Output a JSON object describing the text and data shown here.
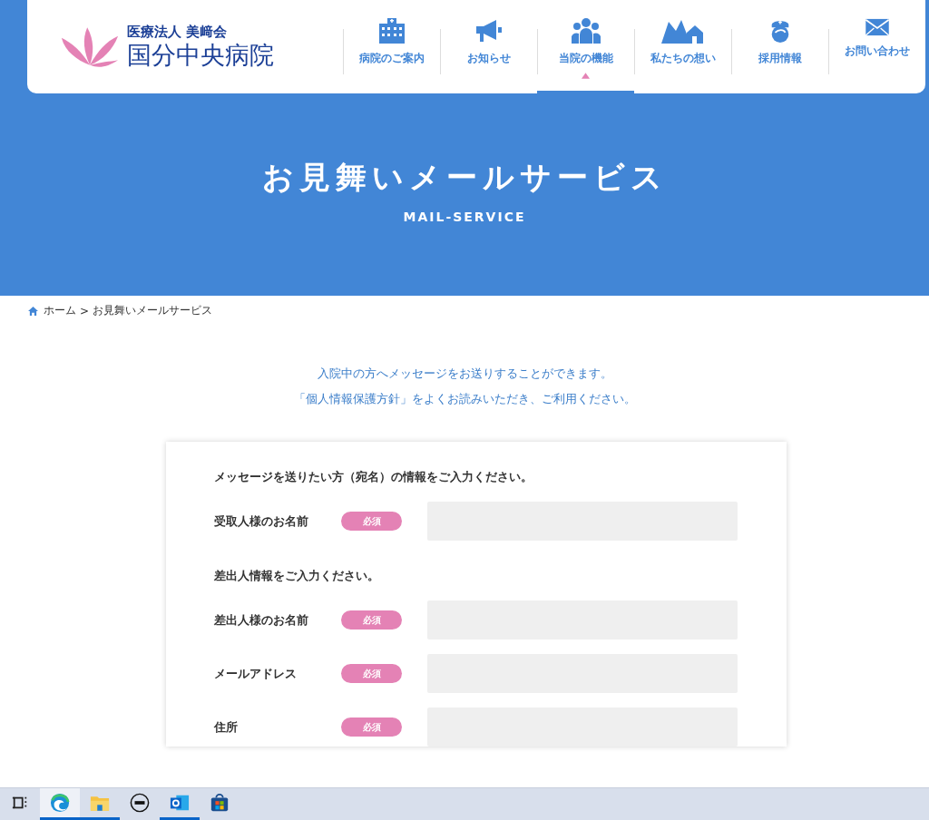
{
  "header": {
    "logo": {
      "org": "医療法人 美﨑会",
      "name": "国分中央病院"
    },
    "nav": [
      {
        "label": "病院のご案内",
        "selected": false
      },
      {
        "label": "お知らせ",
        "selected": false
      },
      {
        "label": "当院の機能",
        "selected": true
      },
      {
        "label": "私たちの想い",
        "selected": false
      },
      {
        "label": "採用情報",
        "selected": false
      },
      {
        "label": "お問い合わせ",
        "selected": false
      }
    ]
  },
  "hero": {
    "title": "お見舞いメールサービス",
    "subtitle": "MAIL-SERVICE"
  },
  "breadcrumb": [
    {
      "label": "ホーム"
    },
    {
      "label": ">"
    },
    {
      "label": "お見舞いメールサービス"
    }
  ],
  "intro": [
    "入院中の方へメッセージをお送りすることができます。",
    "「個人情報保護方針」をよくお読みいただき、ご利用ください。"
  ],
  "form": {
    "sections": [
      {
        "heading": "メッセージを送りたい方（宛名）の情報をご入力ください。",
        "fields": [
          {
            "label": "受取人様のお名前",
            "required": true,
            "badge": "必須"
          }
        ]
      },
      {
        "heading": "差出人情報をご入力ください。",
        "fields": [
          {
            "label": "差出人様のお名前",
            "required": true,
            "badge": "必須"
          },
          {
            "label": "メールアドレス",
            "required": true,
            "badge": "必須"
          },
          {
            "label": "住所",
            "required": true,
            "badge": "必須"
          }
        ]
      }
    ]
  },
  "taskbar": {
    "items": [
      {
        "kind": "taskview",
        "selected": false,
        "running": false
      },
      {
        "kind": "edge",
        "selected": true,
        "running": true
      },
      {
        "kind": "explorer",
        "selected": false,
        "running": true
      },
      {
        "kind": "dell",
        "selected": false,
        "running": false
      },
      {
        "kind": "outlook",
        "selected": false,
        "running": true
      },
      {
        "kind": "store",
        "selected": false,
        "running": false
      }
    ]
  }
}
